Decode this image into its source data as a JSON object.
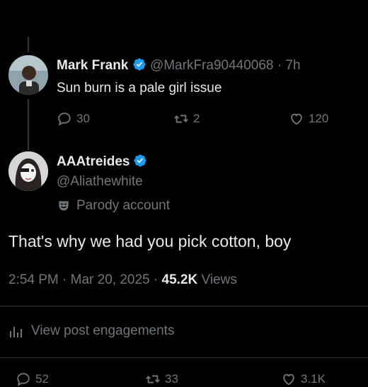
{
  "parent": {
    "name": "Mark Frank",
    "handle": "@MarkFra90440068",
    "time": "· 7h",
    "text": "Sun burn is a pale girl issue",
    "replies": "30",
    "reposts": "2",
    "likes": "120"
  },
  "post": {
    "name": "AAAtreides",
    "handle": "@Aliathewhite",
    "parody_label": "Parody account",
    "text": "That's why we had you pick cotton, boy",
    "time": "2:54 PM",
    "date": "Mar 20, 2025",
    "sep1": "·",
    "sep2": "·",
    "views_count": "45.2K",
    "views_label": "Views"
  },
  "engagements_label": "View post engagements",
  "bottom_actions": {
    "replies": "52",
    "reposts": "33",
    "likes": "3.1K"
  },
  "colors": {
    "background": "#000000",
    "text": "#e7e9ea",
    "secondary": "#71767b",
    "verified": "#1d9bf0"
  },
  "icons": [
    "verified-badge-icon",
    "reply-icon",
    "repost-icon",
    "like-icon",
    "parody-mask-icon",
    "analytics-icon"
  ]
}
